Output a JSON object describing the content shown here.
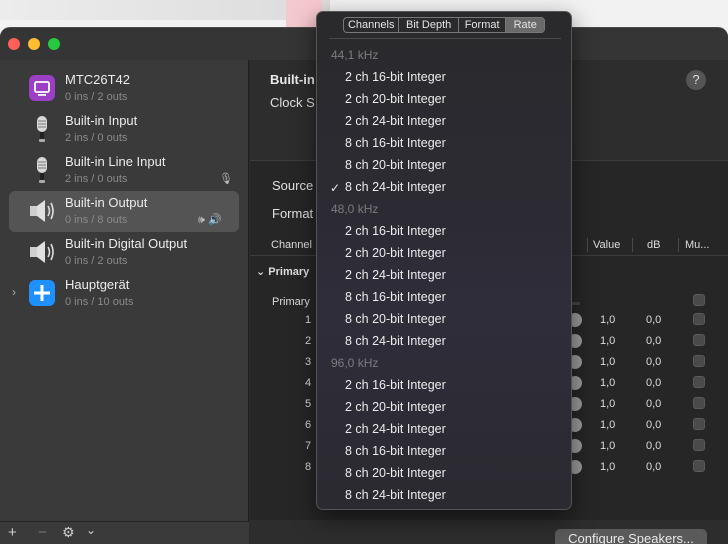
{
  "sidebar": {
    "devices": [
      {
        "name": "MTC26T42",
        "sub": "0 ins / 2 outs",
        "icon": "display-icon"
      },
      {
        "name": "Built-in Input",
        "sub": "2 ins / 0 outs",
        "icon": "microphone-icon"
      },
      {
        "name": "Built-in Line Input",
        "sub": "2 ins / 0 outs",
        "icon": "microphone-icon",
        "right_icon": "🎙"
      },
      {
        "name": "Built-in Output",
        "sub": "0 ins / 8 outs",
        "icon": "speaker-icon",
        "right_icon": "🕪 🔊",
        "selected": true
      },
      {
        "name": "Built-in Digital Output",
        "sub": "0 ins / 2 outs",
        "icon": "speaker-icon"
      },
      {
        "name": "Hauptgerät",
        "sub": "0 ins / 10 outs",
        "icon": "plus-aggregate-icon",
        "chevron": "›"
      }
    ],
    "footer": {
      "add": "+",
      "remove": "−",
      "gear": "⚙",
      "menu": "⌄"
    }
  },
  "main": {
    "title": "Built-in",
    "clock": "Clock S",
    "help": "?",
    "source_label": "Source",
    "format_label": "Format",
    "columns": {
      "channel": "Channel",
      "value": "Value",
      "db": "dB",
      "mute": "Mu..."
    },
    "group": "Primary",
    "primary_row": "Primary",
    "rows": [
      {
        "num": "1",
        "value": "1,0",
        "db": "0,0"
      },
      {
        "num": "2",
        "value": "1,0",
        "db": "0,0"
      },
      {
        "num": "3",
        "value": "1,0",
        "db": "0,0"
      },
      {
        "num": "4",
        "value": "1,0",
        "db": "0,0"
      },
      {
        "num": "5",
        "value": "1,0",
        "db": "0,0"
      },
      {
        "num": "6",
        "value": "1,0",
        "db": "0,0"
      },
      {
        "num": "7",
        "value": "1,0",
        "db": "0,0"
      },
      {
        "num": "8",
        "value": "1,0",
        "db": "0,0"
      }
    ],
    "configure": "Configure Speakers..."
  },
  "popup": {
    "tabs": [
      "Channels",
      "Bit Depth",
      "Format",
      "Rate"
    ],
    "active_tab": "Rate",
    "groups": [
      {
        "header": "44,1 kHz",
        "items": [
          "2 ch 16-bit Integer",
          "2 ch 20-bit Integer",
          "2 ch 24-bit Integer",
          "8 ch 16-bit Integer",
          "8 ch 20-bit Integer",
          "8 ch 24-bit Integer"
        ],
        "checked": 5
      },
      {
        "header": "48,0 kHz",
        "items": [
          "2 ch 16-bit Integer",
          "2 ch 20-bit Integer",
          "2 ch 24-bit Integer",
          "8 ch 16-bit Integer",
          "8 ch 20-bit Integer",
          "8 ch 24-bit Integer"
        ],
        "checked": -1
      },
      {
        "header": "96,0 kHz",
        "items": [
          "2 ch 16-bit Integer",
          "2 ch 20-bit Integer",
          "2 ch 24-bit Integer",
          "8 ch 16-bit Integer",
          "8 ch 20-bit Integer",
          "8 ch 24-bit Integer"
        ],
        "checked": -1
      }
    ],
    "check_glyph": "✓"
  },
  "colors": {
    "close": "#ff5f57",
    "minimize": "#febc2e",
    "maximize": "#28c840",
    "tv_icon": "#9b3fc7",
    "aggregate_icon": "#1e90ff"
  }
}
